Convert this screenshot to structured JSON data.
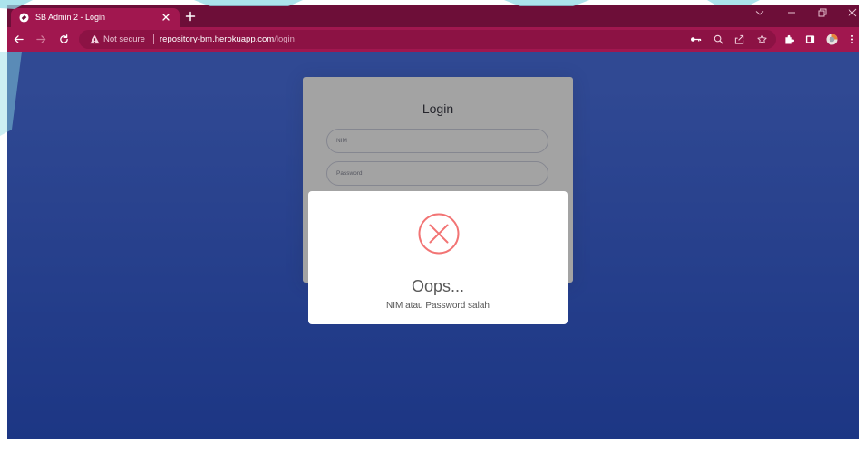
{
  "browser": {
    "tab": {
      "title": "SB Admin 2 - Login",
      "favicon_icon": "site-favicon-icon",
      "close_icon": "close-tab-icon"
    },
    "tab_strip_icons": [
      "new-tab-icon",
      "chevron-down-icon",
      "minimize-icon",
      "restore-icon",
      "close-window-icon"
    ],
    "toolbar": {
      "navigation_icons": [
        "back-arrow-icon",
        "forward-arrow-icon",
        "reload-icon"
      ],
      "security_icon": "warning-triangle-icon",
      "security_label": "Not secure",
      "url_host": "repository-bm.herokuapp.com",
      "url_path": "/login",
      "address_bar_icons": [
        "key-icon",
        "zoom-icon",
        "share-icon",
        "star-icon"
      ],
      "toolbar_icons": [
        "puzzle-icon",
        "side-panel-icon",
        "profile-avatar-icon",
        "kebab-menu-icon"
      ]
    }
  },
  "login": {
    "title": "Login",
    "nim_placeholder": "NIM",
    "password_placeholder": "Password"
  },
  "alert": {
    "icon": "error-x-icon",
    "title": "Oops...",
    "message": "NIM atau Password salah"
  },
  "colors": {
    "tab_strip": "#6d0e38",
    "toolbar": "#a1174f",
    "omnibox": "#8c1244",
    "page_gradient_top": "#4b72e6",
    "page_gradient_bottom": "#2d55cf",
    "error_accent": "#f27474",
    "watermark": "#8fdbe5"
  }
}
